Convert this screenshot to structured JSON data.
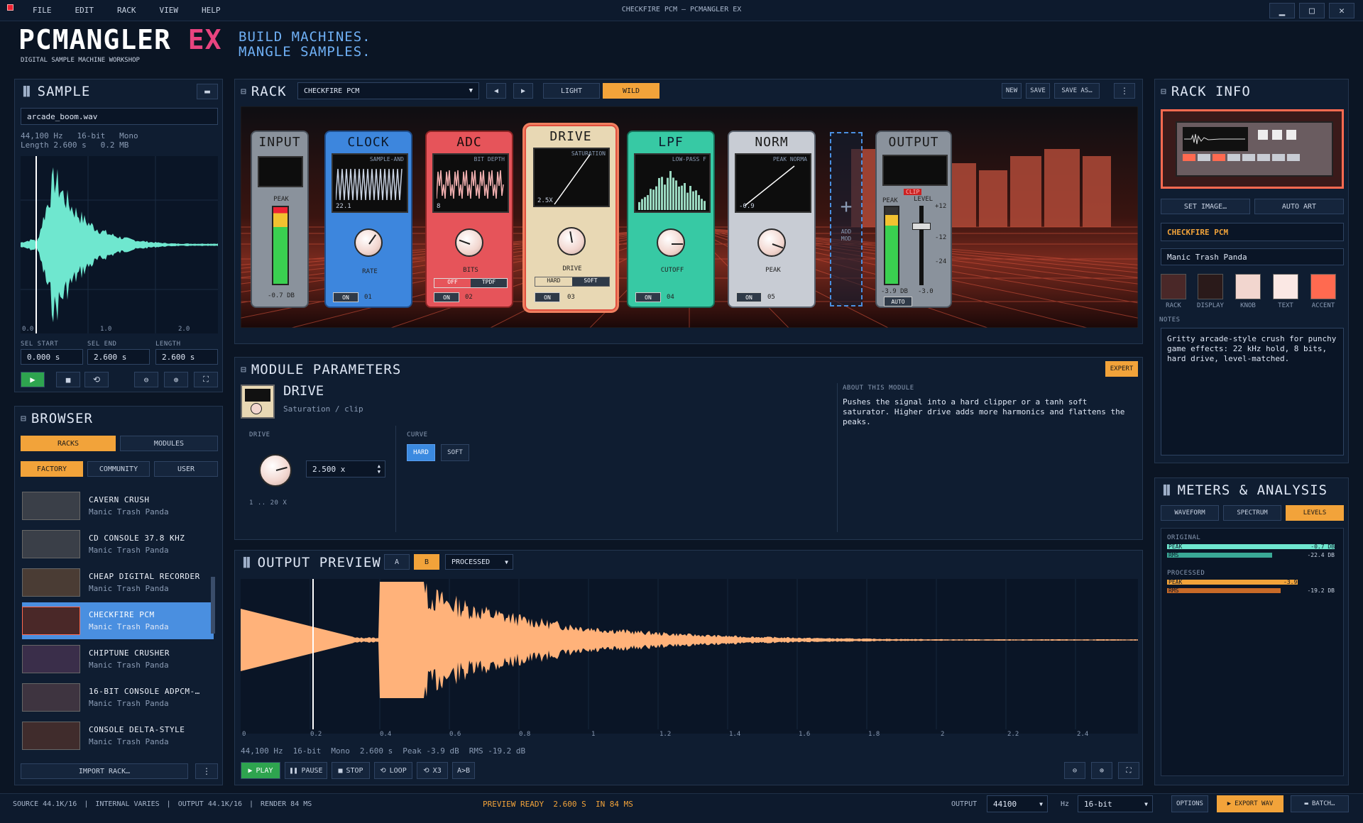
{
  "window": {
    "title": "CHECKFIRE PCM — PCMANGLER EX"
  },
  "menu": [
    "FILE",
    "EDIT",
    "RACK",
    "VIEW",
    "HELP"
  ],
  "brand": {
    "logo": "PCMANGLER",
    "logo_ex": "EX",
    "subtitle": "DIGITAL SAMPLE MACHINE WORKSHOP",
    "tagline1": "BUILD MACHINES.",
    "tagline2": "MANGLE SAMPLES."
  },
  "sample": {
    "title": "SAMPLE",
    "filename": "arcade_boom.wav",
    "rate": "44,100 Hz",
    "bits": "16-bit",
    "channels": "Mono",
    "length": "Length 2.600 s",
    "size": "0.2 MB",
    "ticks": [
      "0.0",
      "1.0",
      "2.0"
    ],
    "sel_start_label": "SEL START",
    "sel_end_label": "SEL END",
    "length_label": "LENGTH",
    "sel_start": "0.000 s",
    "sel_end": "2.600 s",
    "length_val": "2.600 s"
  },
  "browser": {
    "title": "BROWSER",
    "tabs": [
      "RACKS",
      "MODULES"
    ],
    "filters": [
      "FACTORY",
      "COMMUNITY",
      "USER"
    ],
    "items": [
      {
        "name": "CAVERN CRUSH",
        "author": "Manic Trash Panda"
      },
      {
        "name": "CD CONSOLE 37.8 KHZ",
        "author": "Manic Trash Panda"
      },
      {
        "name": "CHEAP DIGITAL RECORDER",
        "author": "Manic Trash Panda"
      },
      {
        "name": "CHECKFIRE PCM",
        "author": "Manic Trash Panda"
      },
      {
        "name": "CHIPTUNE CRUSHER",
        "author": "Manic Trash Panda"
      },
      {
        "name": "16-BIT CONSOLE ADPCM-…",
        "author": "Manic Trash Panda"
      },
      {
        "name": "CONSOLE DELTA-STYLE",
        "author": "Manic Trash Panda"
      }
    ],
    "import": "IMPORT RACK…"
  },
  "rack": {
    "title": "RACK",
    "preset": "CHECKFIRE PCM",
    "modes": [
      "LIGHT",
      "WILD"
    ],
    "buttons": [
      "NEW",
      "SAVE",
      "SAVE AS…"
    ],
    "input": {
      "title": "INPUT",
      "peak": "PEAK",
      "db": "-0.7 DB"
    },
    "clock": {
      "title": "CLOCK",
      "sub": "SAMPLE-AND",
      "val": "22.1",
      "knob": "RATE",
      "on": "ON",
      "num": "01"
    },
    "adc": {
      "title": "ADC",
      "sub": "BIT DEPTH",
      "val": "8",
      "knob": "BITS",
      "off": "OFF",
      "tpdf": "TPDF",
      "on": "ON",
      "num": "02"
    },
    "drive": {
      "title": "DRIVE",
      "sub": "SATURATION",
      "val": "2.5X",
      "knob": "DRIVE",
      "hard": "HARD",
      "soft": "SOFT",
      "on": "ON",
      "num": "03"
    },
    "lpf": {
      "title": "LPF",
      "sub": "LOW-PASS F",
      "knob": "CUTOFF",
      "on": "ON",
      "num": "04"
    },
    "norm": {
      "title": "NORM",
      "sub": "PEAK NORMA",
      "val": "-0.9",
      "knob": "PEAK",
      "on": "ON",
      "num": "05"
    },
    "add": {
      "line1": "ADD",
      "line2": "MOD"
    },
    "output": {
      "title": "OUTPUT",
      "clip": "CLIP",
      "peak": "PEAK",
      "level": "LEVEL",
      "p12": "+12",
      "m12": "-12",
      "m24": "-24",
      "db": "-3.9 DB",
      "lv": "-3.0",
      "auto": "AUTO"
    }
  },
  "params": {
    "title": "MODULE PARAMETERS",
    "expert": "EXPERT",
    "name": "DRIVE",
    "desc": "Saturation / clip",
    "drive_label": "DRIVE",
    "drive_val": "2.500 x",
    "range": "1 .. 20 X",
    "curve_label": "CURVE",
    "curve": [
      "HARD",
      "SOFT"
    ],
    "about_label": "ABOUT THIS MODULE",
    "about": "Pushes the signal into a hard clipper or a tanh soft saturator. Higher drive adds more harmonics and flattens the peaks."
  },
  "preview": {
    "title": "OUTPUT PREVIEW",
    "a": "A",
    "b": "B",
    "mode": "PROCESSED",
    "ticks": [
      "0",
      "0.2",
      "0.4",
      "0.6",
      "0.8",
      "1",
      "1.2",
      "1.4",
      "1.6",
      "1.8",
      "2",
      "2.2",
      "2.4"
    ],
    "info": [
      "44,100 Hz",
      "16-bit",
      "Mono",
      "2.600 s",
      "Peak -3.9 dB",
      "RMS -19.2 dB"
    ],
    "transport": [
      "PLAY",
      "PAUSE",
      "STOP",
      "LOOP",
      "X3",
      "A>B"
    ]
  },
  "rackinfo": {
    "title": "RACK INFO",
    "set_image": "SET IMAGE…",
    "auto_art": "AUTO ART",
    "name": "CHECKFIRE PCM",
    "author": "Manic Trash Panda",
    "swatches": [
      {
        "label": "RACK",
        "color": "#4a2828"
      },
      {
        "label": "DISPLAY",
        "color": "#2a1a1a"
      },
      {
        "label": "KNOB",
        "color": "#f2d6cf"
      },
      {
        "label": "TEXT",
        "color": "#fbe8e4"
      },
      {
        "label": "ACCENT",
        "color": "#ff6a50"
      }
    ],
    "notes_label": "NOTES",
    "notes": "Gritty arcade-style crush for punchy game effects: 22 kHz hold, 8 bits, hard drive, level-matched."
  },
  "meters": {
    "title": "METERS & ANALYSIS",
    "tabs": [
      "WAVEFORM",
      "SPECTRUM",
      "LEVELS"
    ],
    "original": "ORIGINAL",
    "processed": "PROCESSED",
    "peak": "PEAK",
    "rms": "RMS",
    "orig_peak": "-0.7 DB",
    "orig_rms": "-22.4 DB",
    "proc_peak": "-3.9",
    "proc_rms": "-19.2 DB"
  },
  "status": {
    "source": "SOURCE 44.1K/16",
    "internal": "INTERNAL VARIES",
    "output": "OUTPUT 44.1K/16",
    "render": "RENDER 84 MS",
    "ready": "PREVIEW READY  2.600 S  IN 84 MS",
    "output_label": "OUTPUT",
    "rate": "44100",
    "hz": "Hz",
    "bits": "16-bit",
    "options": "OPTIONS",
    "export": "EXPORT WAV",
    "batch": "BATCH…"
  }
}
